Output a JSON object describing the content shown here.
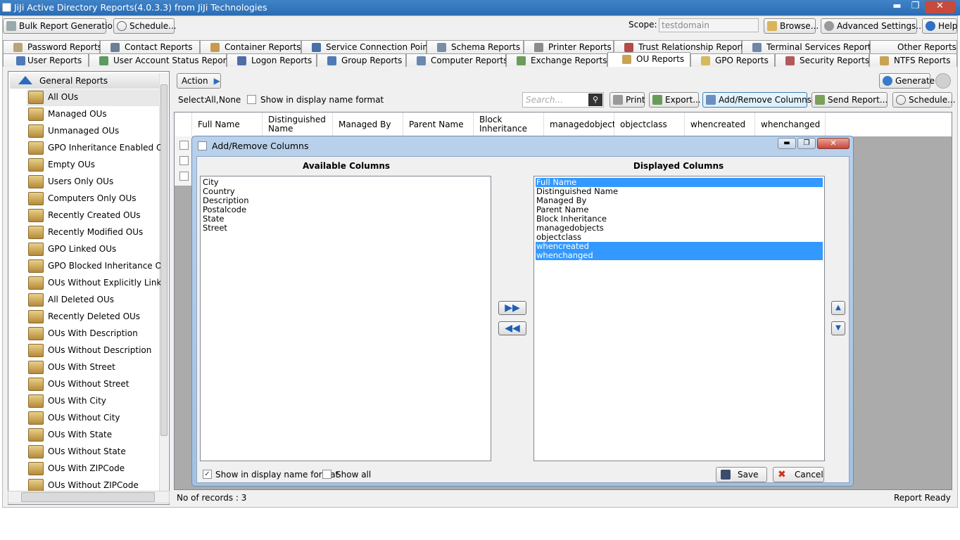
{
  "window": {
    "title": "JiJi Active Directory Reports(4.0.3.3) from JiJi Technologies",
    "minimize": "▬",
    "maximize": "❐",
    "close": "✕"
  },
  "toolbar": {
    "bulk_report": "Bulk Report Generation...",
    "schedule": "Schedule...",
    "scope_label": "Scope:",
    "scope_value": "testdomain",
    "browse": "Browse...",
    "advanced_settings": "Advanced Settings...",
    "help": "Help"
  },
  "tabs_row1": [
    "Password Reports",
    "Contact Reports",
    "Container Reports",
    "Service Connection Point",
    "Schema Reports",
    "Printer Reports",
    "Trust Relationship Reports",
    "Terminal Services Reports",
    "Other Reports"
  ],
  "tabs_row2": [
    "User Reports",
    "User Account Status Reports",
    "Logon Reports",
    "Group Reports",
    "Computer Reports",
    "Exchange Reports",
    "OU Reports",
    "GPO Reports",
    "Security Reports",
    "NTFS Reports"
  ],
  "sidebar": {
    "header": "General Reports",
    "items": [
      "All OUs",
      "Managed OUs",
      "Unmanaged OUs",
      "GPO Inheritance Enabled OUs",
      "Empty OUs",
      "Users Only OUs",
      "Computers Only OUs",
      "Recently Created OUs",
      "Recently Modified OUs",
      "GPO Linked OUs",
      "GPO Blocked Inheritance OUs",
      "OUs Without Explicitly Linked GP",
      "All Deleted OUs",
      "Recently Deleted OUs",
      "OUs With Description",
      "OUs Without Description",
      "OUs With Street",
      "OUs Without Street",
      "OUs With City",
      "OUs Without City",
      "OUs With State",
      "OUs Without State",
      "OUs With ZIPCode",
      "OUs Without ZIPCode"
    ]
  },
  "report_toolbar": {
    "action": "Action",
    "select_label": "Select:",
    "select_all": "All,",
    "select_none": "None",
    "display_name_format": "Show in display name format",
    "search_placeholder": "Search...",
    "print": "Print",
    "export": "Export...",
    "add_remove_columns": "Add/Remove Columns...",
    "send_report": "Send Report...",
    "schedule": "Schedule...",
    "generate": "Generate"
  },
  "grid": {
    "columns": [
      "Full Name",
      "Distinguished Name",
      "Managed By",
      "Parent Name",
      "Block Inheritance",
      "managedobjects",
      "objectclass",
      "whencreated",
      "whenchanged"
    ]
  },
  "dialog": {
    "title": "Add/Remove Columns",
    "available_title": "Available Columns",
    "displayed_title": "Displayed Columns",
    "available": [
      "City",
      "Country",
      "Description",
      "Postalcode",
      "State",
      "Street"
    ],
    "displayed": [
      "Full Name",
      "Distinguished Name",
      "Managed By",
      "Parent Name",
      "Block Inheritance",
      "managedobjects",
      "objectclass",
      "whencreated",
      "whenchanged"
    ],
    "show_display_name": "Show in display name format",
    "show_all": "Show all",
    "save": "Save",
    "cancel": "Cancel"
  },
  "status": {
    "records": "No of records : 3",
    "ready": "Report Ready"
  }
}
